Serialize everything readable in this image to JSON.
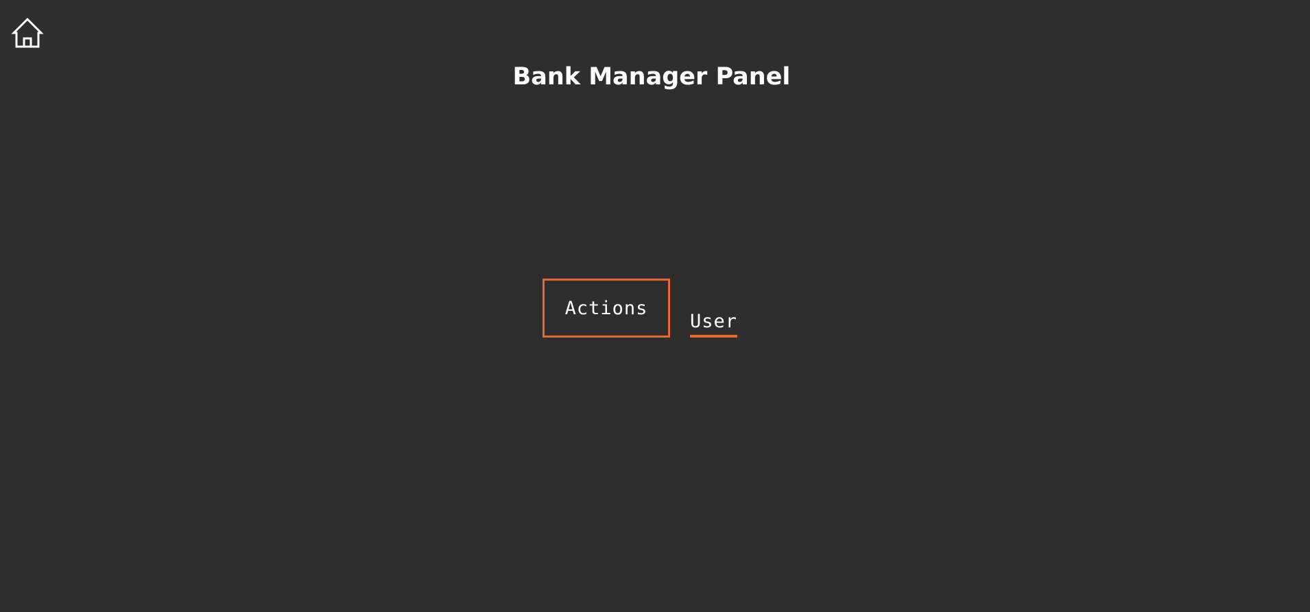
{
  "header": {
    "home_icon": "home-icon",
    "title": "Bank Manager Panel"
  },
  "nav": {
    "actions_label": "Actions",
    "user_label": "User",
    "active_tab": "Actions"
  },
  "colors": {
    "background": "#2e2e2e",
    "accent": "#e8672c",
    "text": "#ffffff"
  }
}
